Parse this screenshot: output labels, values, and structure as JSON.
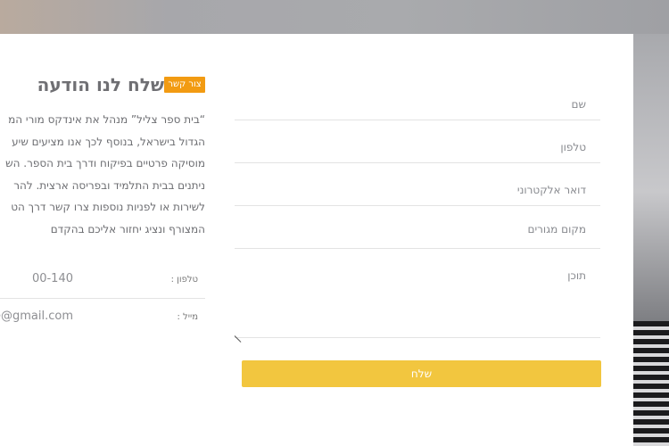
{
  "form": {
    "fields": [
      {
        "label": "שם"
      },
      {
        "label": "טלפון"
      },
      {
        "label": "דואר אלקטרוני"
      },
      {
        "label": "מקום מגורים"
      },
      {
        "label": "תוכן"
      }
    ],
    "submit_label": "שלח"
  },
  "info": {
    "badge": "צור קשר",
    "title": "שלח לנו הודעה",
    "paragraph_lines": [
      "“בית ספר צליל” מנהל את אינדקס מורי המ",
      "הגדול בישראל, בנוסף לכך אנו מציעים שיע",
      "מוסיקה פרטיים בפיקוח ודרך בית הספר. הש",
      "ניתנים בבית התלמיד ובפריסה ארצית. להר",
      "לשירות או לפניות נוספות צרו קשר דרך הט",
      "המצורף ונציג יחזור אליכם בהקדם"
    ],
    "phone_label": "טלפון :",
    "phone_value": "00-140",
    "email_label": "מייל :",
    "email_value": "e@gmail.com"
  }
}
